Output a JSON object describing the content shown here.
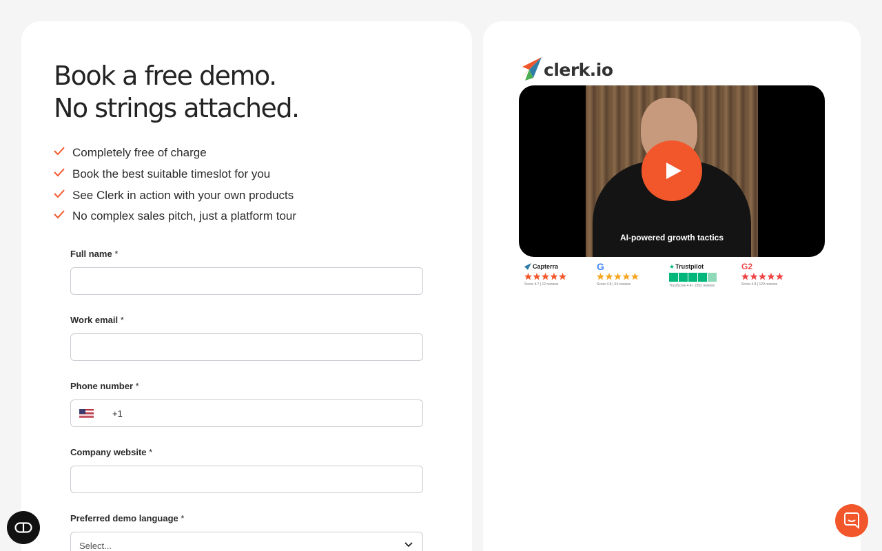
{
  "headline": {
    "line1": "Book a free demo.",
    "line2": "No strings attached."
  },
  "benefits": [
    "Completely free of charge",
    "Book the best suitable timeslot for you",
    "See Clerk in action with your own products",
    "No complex sales pitch, just a platform tour"
  ],
  "form": {
    "full_name": {
      "label": "Full name",
      "required": "*",
      "value": ""
    },
    "work_email": {
      "label": "Work email",
      "required": "*",
      "value": ""
    },
    "phone": {
      "label": "Phone number",
      "required": "*",
      "country": "us-flag-icon",
      "code": "+1",
      "value": ""
    },
    "company_website": {
      "label": "Company website",
      "required": "*",
      "value": ""
    },
    "demo_language": {
      "label": "Preferred demo language",
      "required": "*",
      "selected": "Select..."
    }
  },
  "brand": {
    "logo_text": "clerk.io",
    "accent": "#f2572b"
  },
  "video": {
    "caption": "AI-powered growth tactics",
    "play_icon": "play-icon"
  },
  "reviews": [
    {
      "name": "Capterra",
      "score": "Score 4.7 | 12 reviews",
      "star_color": "#f2572b"
    },
    {
      "name": "G",
      "score": "Score 4.8 | 64 reviews",
      "star_color": "#f5a623"
    },
    {
      "name": "Trustpilot",
      "score": "TrustScore 4.4 | 1552 reviews",
      "star_color": "#00b67a"
    },
    {
      "name": "G2",
      "score": "Score 4.8 | 120 reviews",
      "star_color": "#ef4444"
    }
  ]
}
